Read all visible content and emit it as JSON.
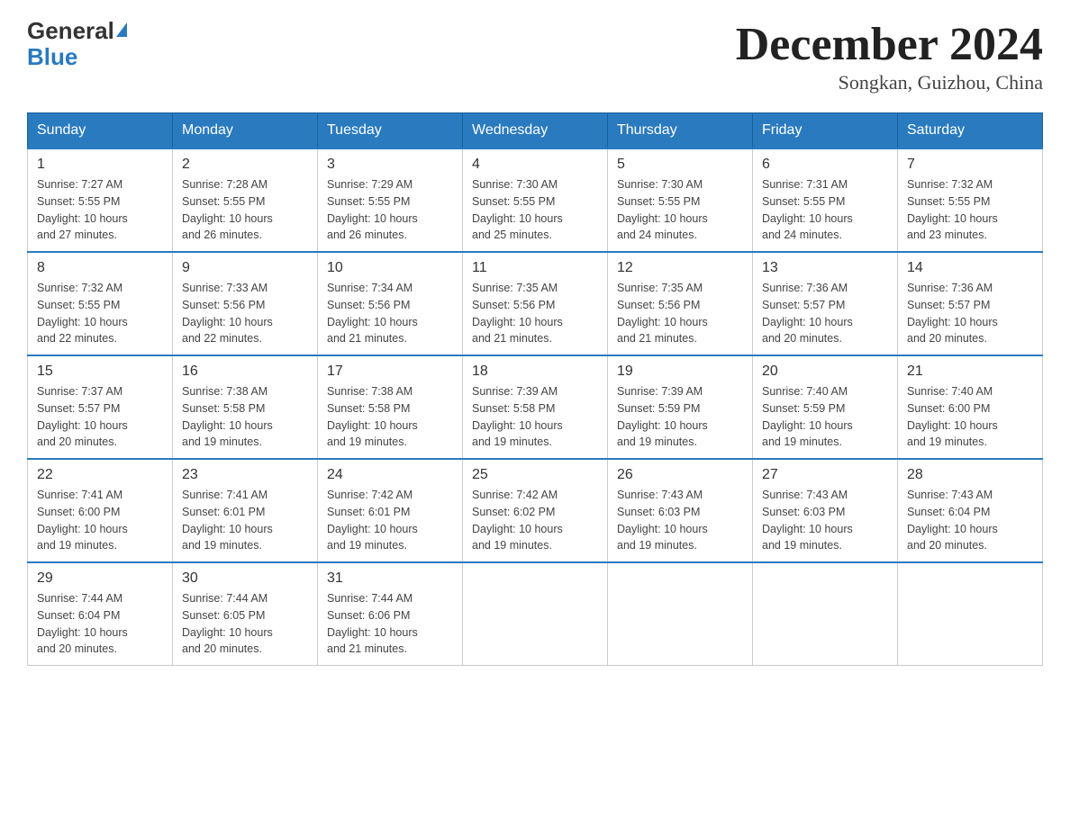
{
  "header": {
    "logo_general": "General",
    "logo_blue": "Blue",
    "title": "December 2024",
    "subtitle": "Songkan, Guizhou, China"
  },
  "days_of_week": [
    "Sunday",
    "Monday",
    "Tuesday",
    "Wednesday",
    "Thursday",
    "Friday",
    "Saturday"
  ],
  "weeks": [
    [
      {
        "day": "1",
        "sunrise": "7:27 AM",
        "sunset": "5:55 PM",
        "daylight": "10 hours and 27 minutes."
      },
      {
        "day": "2",
        "sunrise": "7:28 AM",
        "sunset": "5:55 PM",
        "daylight": "10 hours and 26 minutes."
      },
      {
        "day": "3",
        "sunrise": "7:29 AM",
        "sunset": "5:55 PM",
        "daylight": "10 hours and 26 minutes."
      },
      {
        "day": "4",
        "sunrise": "7:30 AM",
        "sunset": "5:55 PM",
        "daylight": "10 hours and 25 minutes."
      },
      {
        "day": "5",
        "sunrise": "7:30 AM",
        "sunset": "5:55 PM",
        "daylight": "10 hours and 24 minutes."
      },
      {
        "day": "6",
        "sunrise": "7:31 AM",
        "sunset": "5:55 PM",
        "daylight": "10 hours and 24 minutes."
      },
      {
        "day": "7",
        "sunrise": "7:32 AM",
        "sunset": "5:55 PM",
        "daylight": "10 hours and 23 minutes."
      }
    ],
    [
      {
        "day": "8",
        "sunrise": "7:32 AM",
        "sunset": "5:55 PM",
        "daylight": "10 hours and 22 minutes."
      },
      {
        "day": "9",
        "sunrise": "7:33 AM",
        "sunset": "5:56 PM",
        "daylight": "10 hours and 22 minutes."
      },
      {
        "day": "10",
        "sunrise": "7:34 AM",
        "sunset": "5:56 PM",
        "daylight": "10 hours and 21 minutes."
      },
      {
        "day": "11",
        "sunrise": "7:35 AM",
        "sunset": "5:56 PM",
        "daylight": "10 hours and 21 minutes."
      },
      {
        "day": "12",
        "sunrise": "7:35 AM",
        "sunset": "5:56 PM",
        "daylight": "10 hours and 21 minutes."
      },
      {
        "day": "13",
        "sunrise": "7:36 AM",
        "sunset": "5:57 PM",
        "daylight": "10 hours and 20 minutes."
      },
      {
        "day": "14",
        "sunrise": "7:36 AM",
        "sunset": "5:57 PM",
        "daylight": "10 hours and 20 minutes."
      }
    ],
    [
      {
        "day": "15",
        "sunrise": "7:37 AM",
        "sunset": "5:57 PM",
        "daylight": "10 hours and 20 minutes."
      },
      {
        "day": "16",
        "sunrise": "7:38 AM",
        "sunset": "5:58 PM",
        "daylight": "10 hours and 19 minutes."
      },
      {
        "day": "17",
        "sunrise": "7:38 AM",
        "sunset": "5:58 PM",
        "daylight": "10 hours and 19 minutes."
      },
      {
        "day": "18",
        "sunrise": "7:39 AM",
        "sunset": "5:58 PM",
        "daylight": "10 hours and 19 minutes."
      },
      {
        "day": "19",
        "sunrise": "7:39 AM",
        "sunset": "5:59 PM",
        "daylight": "10 hours and 19 minutes."
      },
      {
        "day": "20",
        "sunrise": "7:40 AM",
        "sunset": "5:59 PM",
        "daylight": "10 hours and 19 minutes."
      },
      {
        "day": "21",
        "sunrise": "7:40 AM",
        "sunset": "6:00 PM",
        "daylight": "10 hours and 19 minutes."
      }
    ],
    [
      {
        "day": "22",
        "sunrise": "7:41 AM",
        "sunset": "6:00 PM",
        "daylight": "10 hours and 19 minutes."
      },
      {
        "day": "23",
        "sunrise": "7:41 AM",
        "sunset": "6:01 PM",
        "daylight": "10 hours and 19 minutes."
      },
      {
        "day": "24",
        "sunrise": "7:42 AM",
        "sunset": "6:01 PM",
        "daylight": "10 hours and 19 minutes."
      },
      {
        "day": "25",
        "sunrise": "7:42 AM",
        "sunset": "6:02 PM",
        "daylight": "10 hours and 19 minutes."
      },
      {
        "day": "26",
        "sunrise": "7:43 AM",
        "sunset": "6:03 PM",
        "daylight": "10 hours and 19 minutes."
      },
      {
        "day": "27",
        "sunrise": "7:43 AM",
        "sunset": "6:03 PM",
        "daylight": "10 hours and 19 minutes."
      },
      {
        "day": "28",
        "sunrise": "7:43 AM",
        "sunset": "6:04 PM",
        "daylight": "10 hours and 20 minutes."
      }
    ],
    [
      {
        "day": "29",
        "sunrise": "7:44 AM",
        "sunset": "6:04 PM",
        "daylight": "10 hours and 20 minutes."
      },
      {
        "day": "30",
        "sunrise": "7:44 AM",
        "sunset": "6:05 PM",
        "daylight": "10 hours and 20 minutes."
      },
      {
        "day": "31",
        "sunrise": "7:44 AM",
        "sunset": "6:06 PM",
        "daylight": "10 hours and 21 minutes."
      },
      null,
      null,
      null,
      null
    ]
  ],
  "labels": {
    "sunrise": "Sunrise:",
    "sunset": "Sunset:",
    "daylight": "Daylight:"
  }
}
